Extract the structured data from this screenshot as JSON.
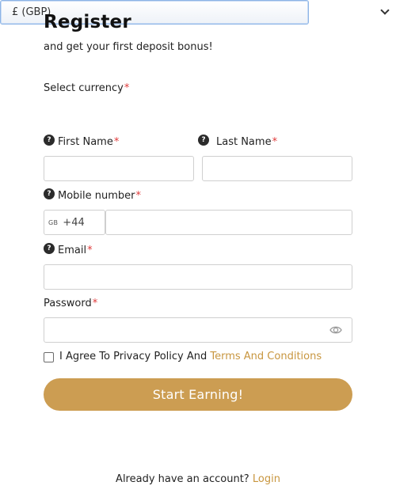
{
  "form": {
    "title": "Register",
    "subtitle": "and get your first deposit bonus!",
    "required_mark": "*",
    "help_glyph": "?",
    "currency": {
      "label": "Select currency",
      "value": "£ (GBP)"
    },
    "first_name": {
      "label": "First Name",
      "value": ""
    },
    "last_name": {
      "label": "Last Name",
      "value": ""
    },
    "mobile": {
      "label": "Mobile number",
      "country_code": "GB",
      "dial_code": "+44",
      "value": ""
    },
    "email": {
      "label": "Email",
      "value": ""
    },
    "password": {
      "label": "Password",
      "value": ""
    },
    "agree": {
      "text": "I Agree To Privacy Policy And",
      "link": "Terms And Conditions",
      "checked": false
    },
    "submit_label": "Start Earning!",
    "login_prompt": "Already have an account?",
    "login_link": "Login"
  },
  "colors": {
    "accent": "#cc9d52",
    "link": "#c8963f",
    "required": "#e03a3a",
    "select_border": "#8db4e6"
  },
  "icons": {
    "help": "question-circle-icon",
    "password_toggle": "eye-icon",
    "dropdown": "chevron-down-icon"
  }
}
